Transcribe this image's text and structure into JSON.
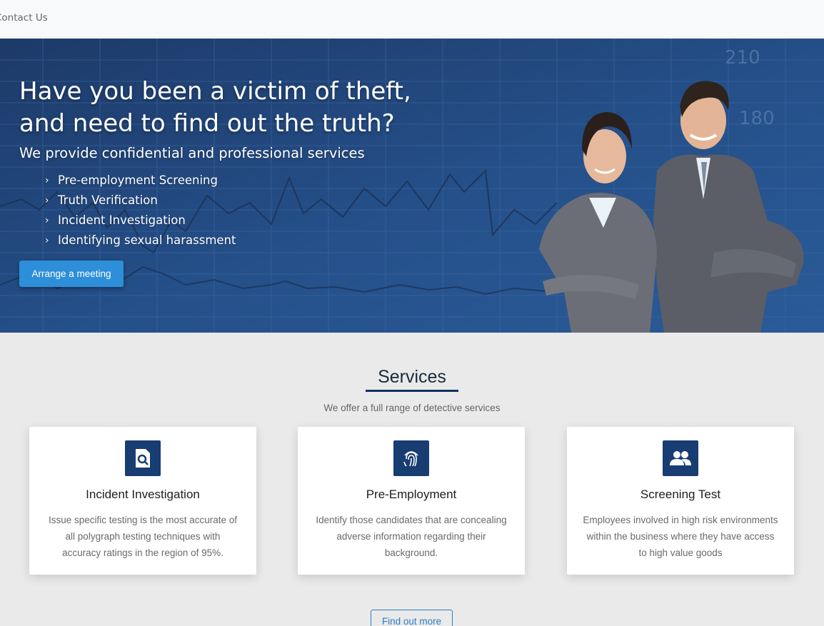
{
  "nav": {
    "contact_label": "Contact Us"
  },
  "hero": {
    "headline_line1": "Have you been a victim of theft,",
    "headline_line2": "and need to find out the truth?",
    "subheadline": "We provide confidential and professional services",
    "bullets": [
      "Pre-employment Screening",
      "Truth Verification",
      "Incident Investigation",
      "Identifying sexual harassment"
    ],
    "cta_label": "Arrange a meeting",
    "chart_numbers": [
      "210",
      "180"
    ]
  },
  "services": {
    "title": "Services",
    "subtitle": "We offer a full range of detective services",
    "cards": [
      {
        "icon": "document-search-icon",
        "title": "Incident Investigation",
        "description": "Issue specific testing is the most accurate of all polygraph testing techniques with accuracy ratings in the region of 95%."
      },
      {
        "icon": "fingerprint-icon",
        "title": "Pre-Employment",
        "description": "Identify those candidates that are concealing adverse information regarding their background."
      },
      {
        "icon": "users-icon",
        "title": "Screening Test",
        "description": "Employees involved in high risk environments within the business where they have access to high value goods"
      }
    ],
    "more_label": "Find out more"
  },
  "colors": {
    "accent": "#2d8fd9",
    "icon_bg": "#173d72",
    "hero_bg": "#25508a",
    "title_rule": "#13305e"
  }
}
